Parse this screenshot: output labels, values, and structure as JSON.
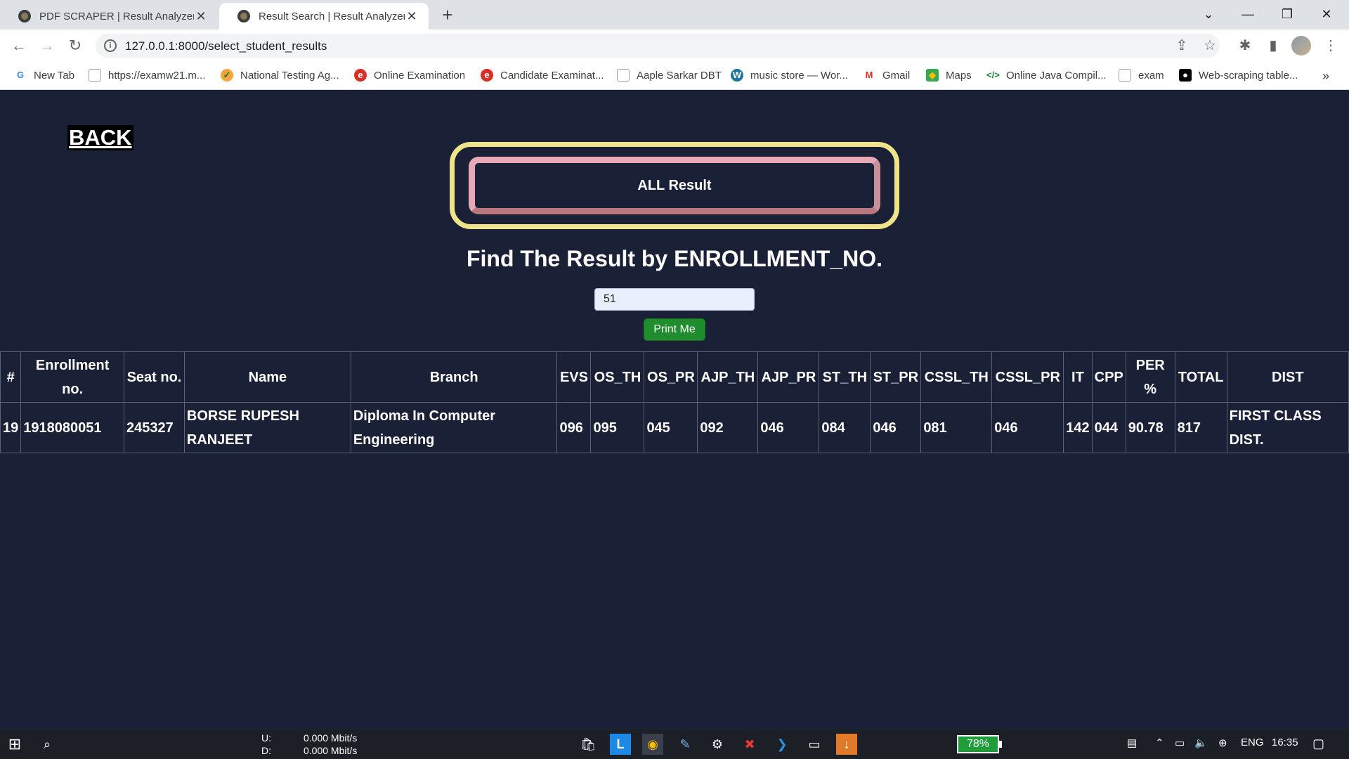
{
  "browser": {
    "tabs": [
      {
        "title": "PDF SCRAPER | Result Analyzer S"
      },
      {
        "title": "Result Search | Result Analyzer Sy"
      }
    ],
    "url": "127.0.0.1:8000/select_student_results",
    "bookmarks": [
      {
        "label": "New Tab"
      },
      {
        "label": "https://examw21.m..."
      },
      {
        "label": "National Testing Ag..."
      },
      {
        "label": "Online Examination"
      },
      {
        "label": "Candidate Examinat..."
      },
      {
        "label": "Aaple Sarkar DBT"
      },
      {
        "label": "music store — Wor..."
      },
      {
        "label": "Gmail"
      },
      {
        "label": "Maps"
      },
      {
        "label": "Online Java Compil..."
      },
      {
        "label": "exam"
      },
      {
        "label": "Web-scraping table..."
      }
    ]
  },
  "page": {
    "back_label": "BACK",
    "all_result_label": "ALL Result",
    "heading": "Find The Result by ENROLLMENT_NO.",
    "enrollment_input_value": "51",
    "print_button_label": "Print Me",
    "table": {
      "headers": [
        "#",
        "Enrollment no.",
        "Seat no.",
        "Name",
        "Branch",
        "EVS",
        "OS_TH",
        "OS_PR",
        "AJP_TH",
        "AJP_PR",
        "ST_TH",
        "ST_PR",
        "CSSL_TH",
        "CSSL_PR",
        "IT",
        "CPP",
        "PER %",
        "TOTAL",
        "DIST"
      ],
      "rows": [
        [
          "19",
          "1918080051",
          "245327",
          "BORSE RUPESH RANJEET",
          "Diploma In Computer Engineering",
          "096",
          "095",
          "045",
          "092",
          "046",
          "084",
          "046",
          "081",
          "046",
          "142",
          "044",
          "90.78",
          "817",
          "FIRST CLASS DIST."
        ]
      ]
    }
  },
  "taskbar": {
    "net_up_label": "U:",
    "net_up_value": "0.000 Mbit/s",
    "net_down_label": "D:",
    "net_down_value": "0.000 Mbit/s",
    "battery": "78%",
    "language": "ENG",
    "time": "16:35"
  }
}
